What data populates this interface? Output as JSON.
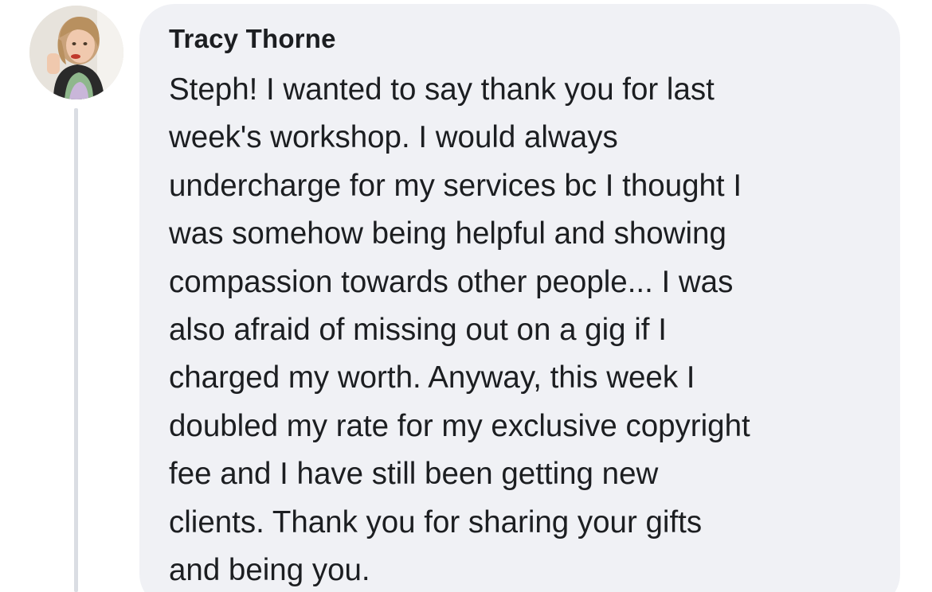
{
  "comment": {
    "author": "Tracy Thorne",
    "lines": [
      "Steph! I wanted to say thank you for last",
      "week's workshop. I would always",
      "undercharge for my services bc I thought I",
      "was somehow being helpful and showing",
      "compassion towards other people... I was",
      "also afraid of missing out on a gig if I",
      "charged my worth. Anyway, this week I",
      "doubled my rate for my exclusive copyright",
      "fee and I have still been getting new",
      "clients. Thank you for sharing your gifts",
      "and being you."
    ]
  },
  "colors": {
    "bubble_background": "#f0f1f5",
    "text": "#1c1e21",
    "thread_line": "#dadde3"
  }
}
